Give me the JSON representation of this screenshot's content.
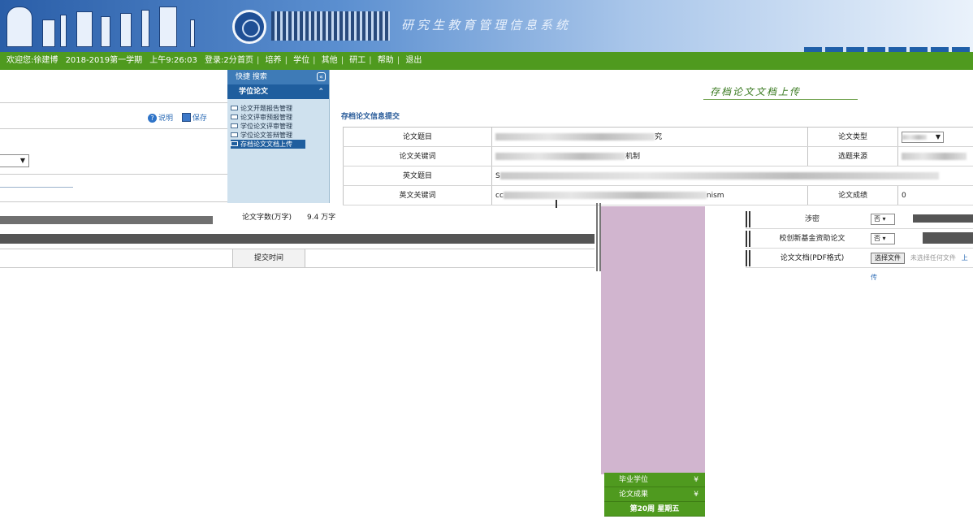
{
  "header": {
    "system_title": "研究生教育管理信息系统"
  },
  "navbar": {
    "welcome": "欢迎您:徐建博",
    "term": "2018-2019第一学期",
    "clock": "上午9:26:03",
    "login_duration": "登录:2分",
    "links": [
      "首页",
      "培养",
      "学位",
      "其他",
      "研工",
      "帮助",
      "退出"
    ]
  },
  "left_panel": {
    "help_label": "说明",
    "save_label": "保存",
    "select_arrow": "▼"
  },
  "sidebar": {
    "shortcuts": "快捷  搜索",
    "group": "学位论文",
    "items": [
      "论文开题报告管理",
      "论文评审预报管理",
      "学位论文评审管理",
      "学位论文答辩管理",
      "存档论文文档上传"
    ],
    "active_index": 4
  },
  "page": {
    "heading": "存档论文文档上传",
    "form_section": "存档论文信息提交"
  },
  "form": {
    "rows": [
      {
        "label": "论文题目",
        "value_suffix": "究",
        "label2": "论文类型",
        "select_arrow": "▼"
      },
      {
        "label": "论文关键词",
        "value_suffix": "机制",
        "label2": "选题来源"
      },
      {
        "label": "英文题目",
        "value_prefix": "S"
      },
      {
        "label": "英文关键词",
        "value_prefix": "cc",
        "value_suffix": "nism",
        "label2": "论文成绩",
        "value2": "0"
      }
    ]
  },
  "middle": {
    "word_count_label": "论文字数(万字)",
    "word_count_value": "9.4 万字",
    "submit_time_label": "提交时间"
  },
  "right_rows": [
    {
      "label": "涉密",
      "value": "否"
    },
    {
      "label": "校创新基金资助论文",
      "value": "否"
    },
    {
      "label": "论文文档(PDF格式)",
      "file_button": "选择文件",
      "file_status": "未选择任何文件",
      "upload": "上传"
    }
  ],
  "green_menu": {
    "items": [
      "毕业学位",
      "论文成果"
    ],
    "week": "第20周 星期五"
  }
}
